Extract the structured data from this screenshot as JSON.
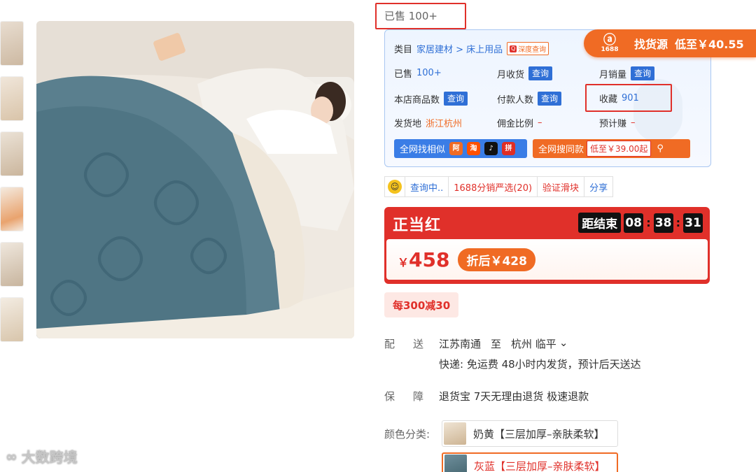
{
  "sold_label": "已售 100+",
  "source_badge": {
    "logo_text": "1688",
    "label": "找货源",
    "price": "低至￥40.55",
    "color": "#f06b24"
  },
  "info": {
    "category_label": "类目",
    "category_value": "家居建材 > 床上用品",
    "deep_query": "深度查询",
    "sold_label": "已售",
    "sold_value": "100+",
    "month_recv_label": "月收货",
    "month_sales_label": "月销量",
    "shop_items_label": "本店商品数",
    "payers_label": "付款人数",
    "fav_label": "收藏",
    "fav_value": "901",
    "ship_from_label": "发货地",
    "ship_from_value": "浙江杭州",
    "commission_label": "佣金比例",
    "commission_value": "–",
    "estimate_label": "预计赚",
    "estimate_value": "–",
    "query_btn": "查询"
  },
  "similar_btn": {
    "label": "全网找相似",
    "icons": [
      "ali-icon",
      "taobao-icon",
      "douyin-icon",
      "pdd-icon"
    ],
    "icon_text": [
      "阿",
      "淘",
      "♪",
      "拼"
    ]
  },
  "same_btn": {
    "label": "全网搜同款",
    "low_price": "低至￥39.00起"
  },
  "toolbar": {
    "querying": "查询中..",
    "distribution": "1688分销严选(20)",
    "verify": "验证滑块",
    "share": "分享"
  },
  "promo": {
    "title": "正当红",
    "countdown_label": "距结束",
    "hours": "08",
    "minutes": "38",
    "seconds": "31",
    "price_symbol": "￥",
    "price": "458",
    "after_discount": "折后￥428",
    "color": "#e0302a"
  },
  "coupon": "每300减30",
  "shipping": {
    "label": "配送:",
    "from": "江苏南通",
    "to_word": "至",
    "dest": "杭州 临平",
    "chevron": "⌄",
    "line2": "快递: 免运费  48小时内发货，预计后天送达"
  },
  "guarantee": {
    "label": "保障:",
    "value": "退货宝 7天无理由退货 极速退款"
  },
  "color_options": {
    "label": "颜色分类:",
    "items": [
      {
        "text": "奶黄【三层加厚–亲肤柔软】",
        "selected": false
      },
      {
        "text": "灰蓝【三层加厚–亲肤柔软】",
        "selected": true
      }
    ]
  },
  "watermark": {
    "logo": "∞",
    "text": "大数跨境"
  }
}
